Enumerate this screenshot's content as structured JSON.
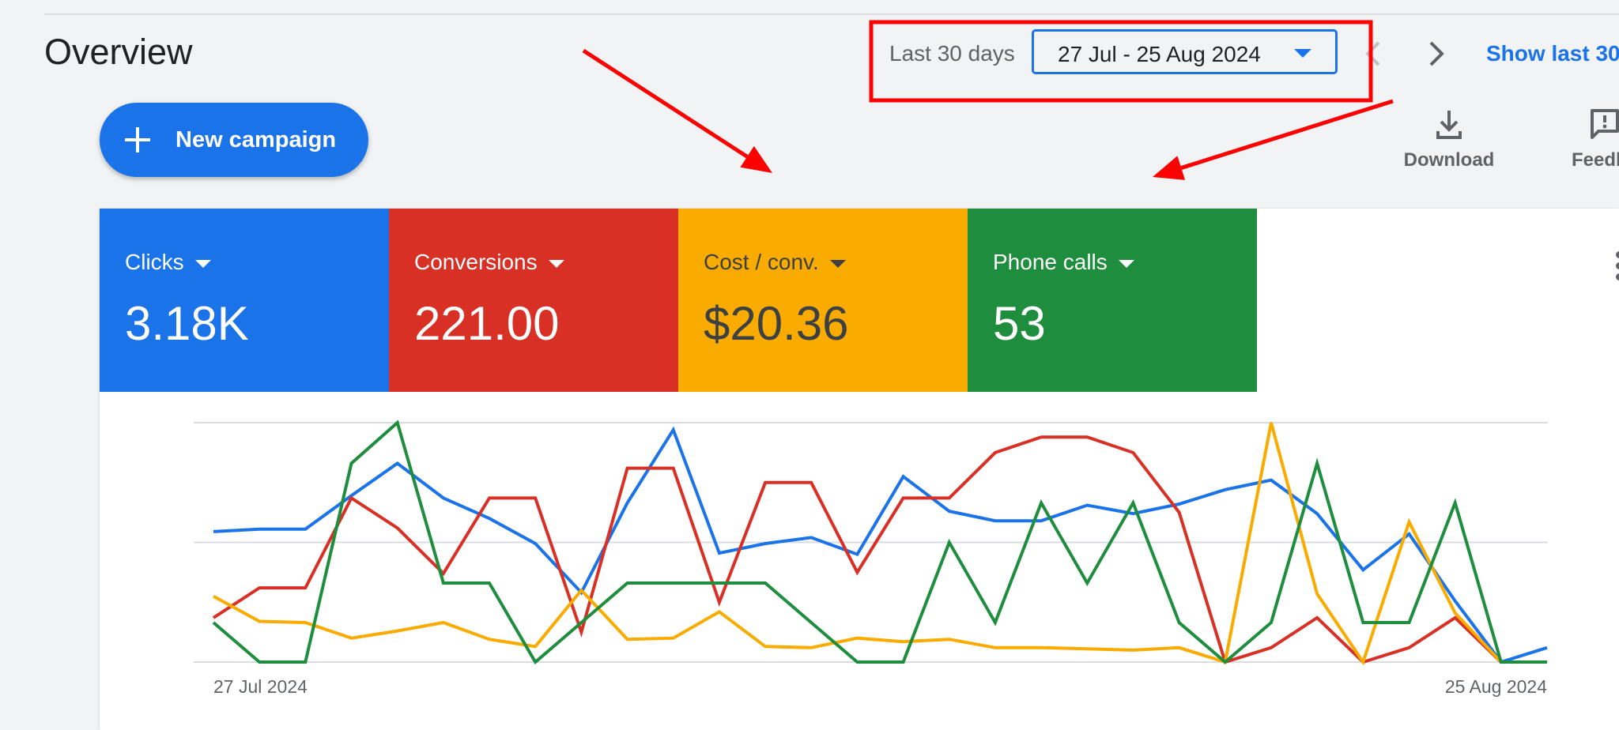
{
  "header": {
    "title": "Overview",
    "date_label": "Last 30 days",
    "date_range": "27 Jul - 25 Aug 2024",
    "show_last": "Show last 30"
  },
  "actions": {
    "new_campaign": "New campaign",
    "download": "Download",
    "feedback": "Feedba"
  },
  "icons": {
    "dropdown": "caret-down-icon",
    "prev": "chevron-left-icon",
    "next": "chevron-right-icon",
    "add": "plus-icon",
    "download": "download-icon",
    "feedback": "feedback-icon",
    "more": "more-vert-icon"
  },
  "scorecards": [
    {
      "name": "Clicks",
      "value": "3.18K",
      "color": "#1a73e8"
    },
    {
      "name": "Conversions",
      "value": "221.00",
      "color": "#d93025"
    },
    {
      "name": "Cost / conv.",
      "value": "$20.36",
      "color": "#f9ab00"
    },
    {
      "name": "Phone calls",
      "value": "53",
      "color": "#1e8e3e"
    }
  ],
  "annotation_color": "#ff0000",
  "chart_data": {
    "type": "line",
    "x_start_label": "27 Jul 2024",
    "x_end_label": "25 Aug 2024",
    "ylim": [
      0,
      1
    ],
    "gridlines": [
      0,
      0.5,
      1
    ],
    "x": [
      "27 Jul",
      "28 Jul",
      "29 Jul",
      "30 Jul",
      "31 Jul",
      "1 Aug",
      "2 Aug",
      "3 Aug",
      "4 Aug",
      "5 Aug",
      "6 Aug",
      "7 Aug",
      "8 Aug",
      "9 Aug",
      "10 Aug",
      "11 Aug",
      "12 Aug",
      "13 Aug",
      "14 Aug",
      "15 Aug",
      "16 Aug",
      "17 Aug",
      "18 Aug",
      "19 Aug",
      "20 Aug",
      "21 Aug",
      "22 Aug",
      "23 Aug",
      "24 Aug",
      "25 Aug"
    ],
    "series": [
      {
        "name": "Clicks",
        "color": "#1a73e8",
        "values": [
          0.545,
          0.555,
          0.555,
          0.695,
          0.83,
          0.685,
          0.6,
          0.495,
          0.29,
          0.665,
          0.97,
          0.455,
          0.495,
          0.52,
          0.45,
          0.775,
          0.63,
          0.59,
          0.59,
          0.655,
          0.62,
          0.66,
          0.72,
          0.76,
          0.62,
          0.385,
          0.535,
          0.255,
          0,
          0.06
        ]
      },
      {
        "name": "Conversions",
        "color": "#d93025",
        "values": [
          0.185,
          0.31,
          0.31,
          0.685,
          0.56,
          0.37,
          0.685,
          0.685,
          0.125,
          0.81,
          0.81,
          0.25,
          0.75,
          0.75,
          0.375,
          0.685,
          0.685,
          0.875,
          0.94,
          0.94,
          0.875,
          0.625,
          0,
          0.06,
          0.185,
          0,
          0.06,
          0.185,
          0,
          0
        ]
      },
      {
        "name": "Cost / conv.",
        "color": "#f9ab00",
        "values": [
          0.275,
          0.17,
          0.165,
          0.1,
          0.13,
          0.165,
          0.095,
          0.065,
          0.3,
          0.095,
          0.1,
          0.21,
          0.065,
          0.06,
          0.1,
          0.085,
          0.095,
          0.06,
          0.06,
          0.055,
          0.05,
          0.06,
          0,
          1,
          0.285,
          0,
          0.585,
          0.205,
          0,
          0
        ]
      },
      {
        "name": "Phone calls",
        "color": "#1e8e3e",
        "values": [
          0.165,
          0,
          0,
          0.83,
          1,
          0.33,
          0.33,
          0,
          0.165,
          0.33,
          0.33,
          0.33,
          0.33,
          0.165,
          0,
          0,
          0.5,
          0.165,
          0.665,
          0.33,
          0.665,
          0.165,
          0,
          0.165,
          0.83,
          0.165,
          0.165,
          0.665,
          0,
          0
        ]
      }
    ]
  }
}
